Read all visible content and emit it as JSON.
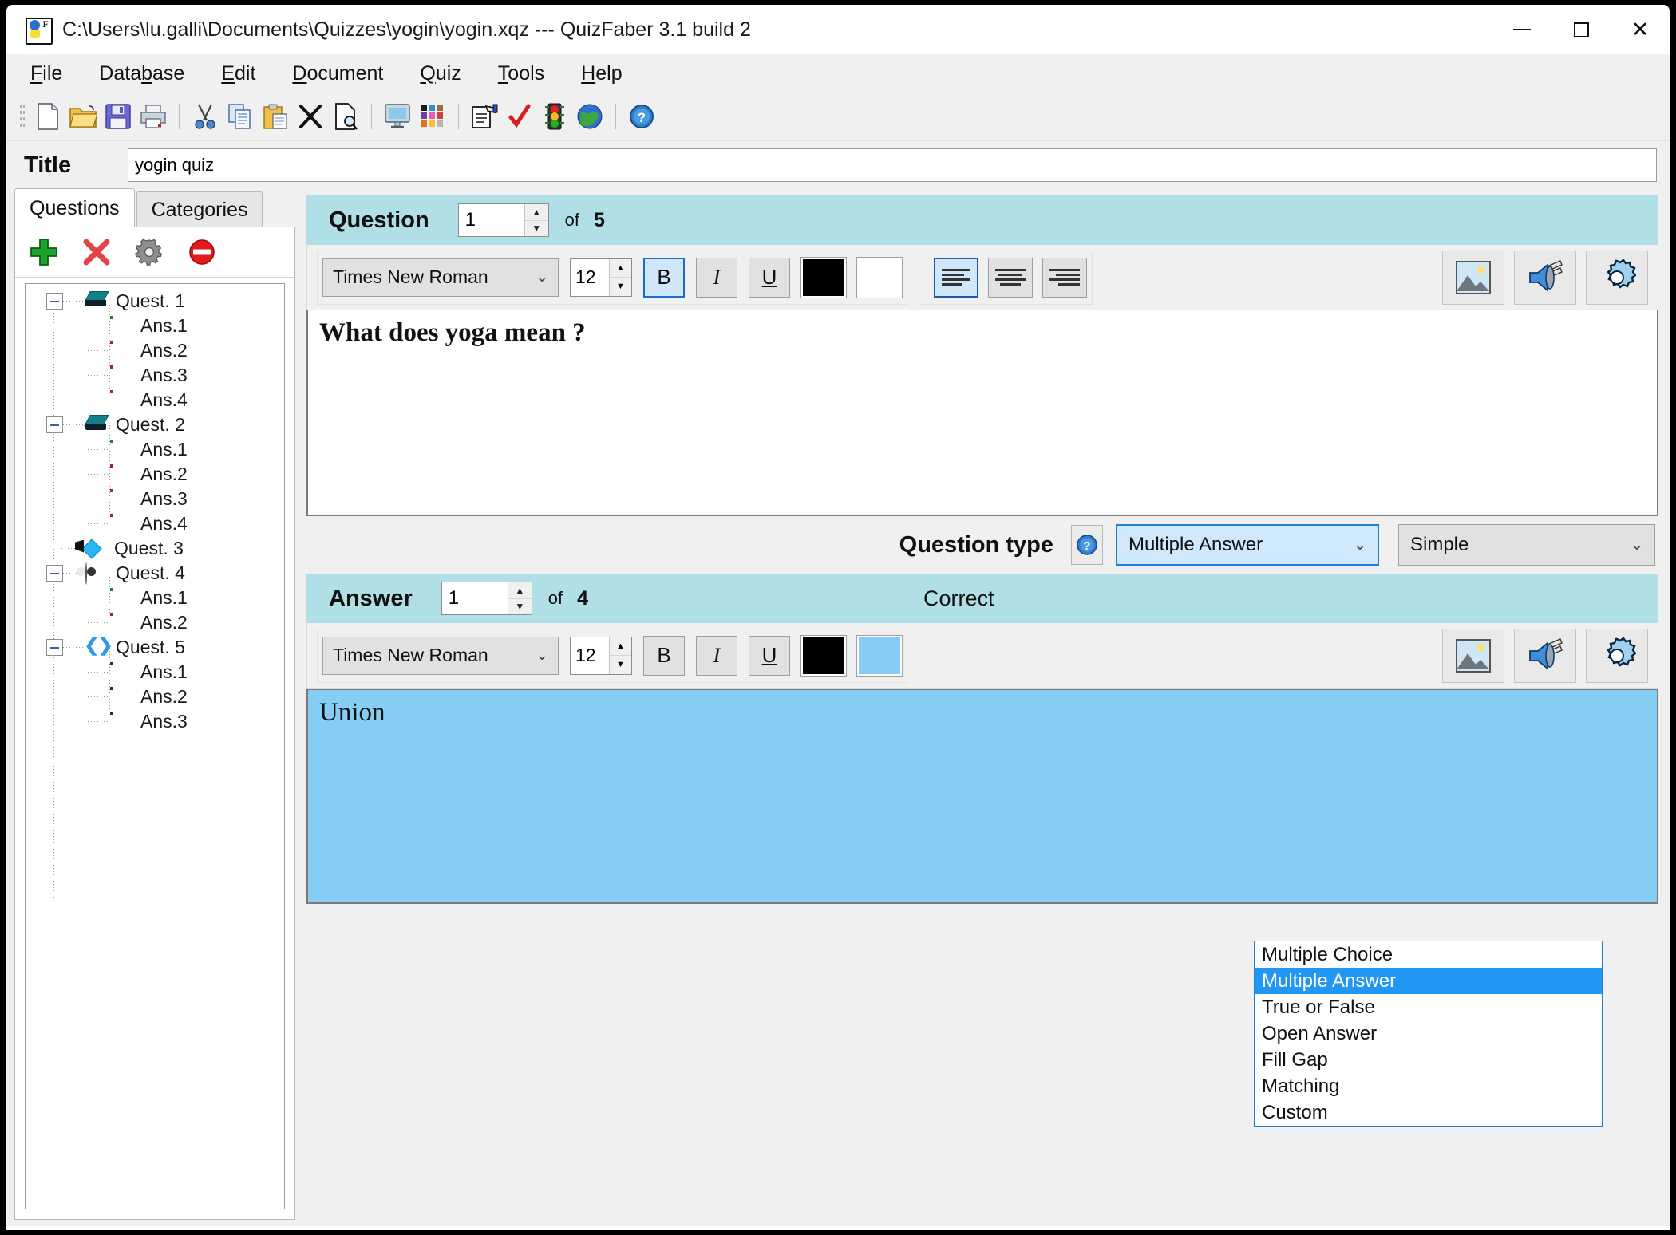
{
  "window": {
    "title": "C:\\Users\\lu.galli\\Documents\\Quizzes\\yogin\\yogin.xqz  ---  QuizFaber 3.1 build 2",
    "minimize": "–",
    "maximize": "□",
    "close": "✕"
  },
  "menu": [
    {
      "label": "File",
      "accel": "F"
    },
    {
      "label": "Database",
      "accel": "b"
    },
    {
      "label": "Edit",
      "accel": "E"
    },
    {
      "label": "Document",
      "accel": "D"
    },
    {
      "label": "Quiz",
      "accel": "Q"
    },
    {
      "label": "Tools",
      "accel": "T"
    },
    {
      "label": "Help",
      "accel": "H"
    }
  ],
  "toolbar": [
    {
      "name": "new-icon"
    },
    {
      "name": "open-icon"
    },
    {
      "name": "save-icon"
    },
    {
      "name": "print-icon"
    },
    {
      "sep": true
    },
    {
      "name": "cut-icon"
    },
    {
      "name": "copy-icon"
    },
    {
      "name": "paste-icon"
    },
    {
      "name": "delete-icon"
    },
    {
      "name": "preview-icon"
    },
    {
      "sep": true
    },
    {
      "name": "monitor-icon"
    },
    {
      "name": "palette-icon"
    },
    {
      "sep": true
    },
    {
      "name": "template-icon"
    },
    {
      "name": "check-icon"
    },
    {
      "name": "trafficlight-icon"
    },
    {
      "name": "globe-icon"
    },
    {
      "sep": true
    },
    {
      "name": "help-icon"
    }
  ],
  "title_row": {
    "label": "Title",
    "value": "yogin quiz",
    "placeholder": ""
  },
  "left": {
    "tabs": [
      {
        "label": "Questions",
        "active": true
      },
      {
        "label": "Categories",
        "active": false
      }
    ],
    "tree_tools": [
      {
        "name": "add-question-button",
        "glyph": "+"
      },
      {
        "name": "delete-question-button",
        "glyph": "✕"
      },
      {
        "name": "question-settings-button",
        "glyph": "gear"
      },
      {
        "name": "disable-question-button",
        "glyph": "deny"
      }
    ],
    "tree": [
      {
        "level": 0,
        "label": "Quest. 1",
        "icon": "book-icon",
        "expanded": true
      },
      {
        "level": 1,
        "label": "Ans.1",
        "icon": "page-green-icon"
      },
      {
        "level": 1,
        "label": "Ans.2",
        "icon": "page-red-icon"
      },
      {
        "level": 1,
        "label": "Ans.3",
        "icon": "page-red-icon"
      },
      {
        "level": 1,
        "label": "Ans.4",
        "icon": "page-red-icon"
      },
      {
        "level": 0,
        "label": "Quest. 2",
        "icon": "book-icon",
        "expanded": true
      },
      {
        "level": 1,
        "label": "Ans.1",
        "icon": "page-green-icon"
      },
      {
        "level": 1,
        "label": "Ans.2",
        "icon": "page-red-icon"
      },
      {
        "level": 1,
        "label": "Ans.3",
        "icon": "page-red-icon"
      },
      {
        "level": 1,
        "label": "Ans.4",
        "icon": "page-red-icon"
      },
      {
        "level": 0,
        "label": "Quest. 3",
        "icon": "paint-icon",
        "expanded": false
      },
      {
        "level": 0,
        "label": "Quest. 4",
        "icon": "yinyang-icon",
        "expanded": true
      },
      {
        "level": 1,
        "label": "Ans.1",
        "icon": "page-green-icon"
      },
      {
        "level": 1,
        "label": "Ans.2",
        "icon": "page-red-icon"
      },
      {
        "level": 0,
        "label": "Quest. 5",
        "icon": "code-icon",
        "expanded": true
      },
      {
        "level": 1,
        "label": "Ans.1",
        "icon": "page-gray-icon"
      },
      {
        "level": 1,
        "label": "Ans.2",
        "icon": "page-gray-icon"
      },
      {
        "level": 1,
        "label": "Ans.3",
        "icon": "page-gray-icon"
      }
    ]
  },
  "question": {
    "heading": "Question",
    "index": "1",
    "of": "of",
    "total": "5",
    "font": "Times New Roman",
    "size": "12",
    "bold_label": "B",
    "italic_label": "I",
    "underline_label": "U",
    "bold_active": true,
    "fore_color": "#000000",
    "back_color": "#ffffff",
    "align": "left",
    "text": "What does yoga mean ?",
    "tool_buttons": [
      {
        "name": "insert-image-button"
      },
      {
        "name": "insert-media-button"
      },
      {
        "name": "question-options-button"
      }
    ]
  },
  "question_type": {
    "label": "Question type",
    "help": "?",
    "selected": "Multiple Answer",
    "options": [
      "Multiple Choice",
      "Multiple Answer",
      "True or False",
      "Open Answer",
      "Fill Gap",
      "Matching",
      "Custom"
    ],
    "variant_selected": "Simple"
  },
  "answer": {
    "heading": "Answer",
    "index": "1",
    "of": "of",
    "total": "4",
    "correct_label": "Correct",
    "font": "Times New Roman",
    "size": "12",
    "bold_label": "B",
    "italic_label": "I",
    "underline_label": "U",
    "bold_active": false,
    "fore_color": "#000000",
    "back_color": "#86cdf5",
    "text": "Union",
    "tool_buttons": [
      {
        "name": "insert-image-button"
      },
      {
        "name": "insert-media-button"
      },
      {
        "name": "answer-options-button"
      }
    ]
  },
  "colors": {
    "section_header": "#b0dfe5",
    "answer_bg": "#86cdf5",
    "highlight": "#2196f3",
    "combo_open": "#cfe8fb"
  }
}
